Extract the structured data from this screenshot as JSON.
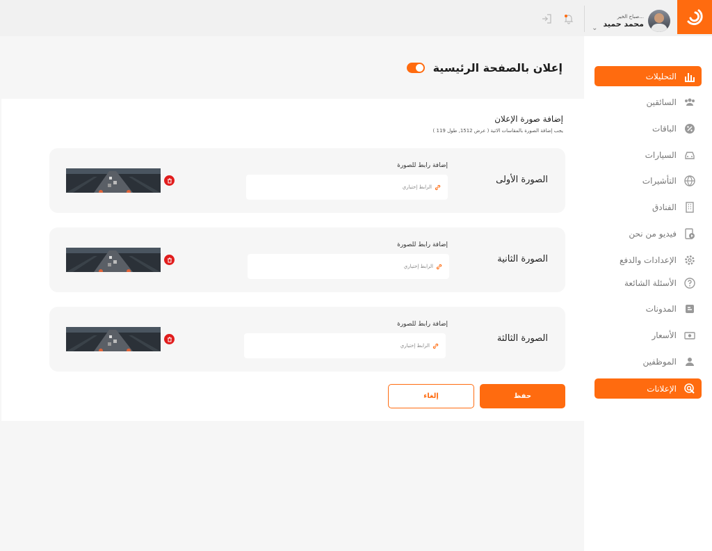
{
  "header": {
    "greeting": "صباح الخير...",
    "user_name": "محمد حميد"
  },
  "sidebar": {
    "items": [
      {
        "label": "التحليلات",
        "icon": "chart-icon",
        "active": true
      },
      {
        "label": "السائقين",
        "icon": "users-icon",
        "active": false
      },
      {
        "label": "الباقات",
        "icon": "discount-icon",
        "active": false
      },
      {
        "label": "السيارات",
        "icon": "car-icon",
        "active": false
      },
      {
        "label": "التأشيرات",
        "icon": "globe-icon",
        "active": false
      },
      {
        "label": "الفنادق",
        "icon": "building-icon",
        "active": false
      },
      {
        "label": "فيديو من نحن",
        "icon": "video-icon",
        "active": false
      },
      {
        "label": "الإعدادات والدفع",
        "icon": "gear-icon",
        "active": false
      },
      {
        "label": "الأسئلة الشائعة",
        "icon": "question-icon",
        "active": false
      },
      {
        "label": "المدونات",
        "icon": "blog-icon",
        "active": false
      },
      {
        "label": "الأسعار",
        "icon": "money-icon",
        "active": false
      },
      {
        "label": "الموظفين",
        "icon": "person-icon",
        "active": false
      },
      {
        "label": "الإعلانات",
        "icon": "ads-icon",
        "active": true
      }
    ]
  },
  "page": {
    "title": "إعلان بالصفحة الرئيسية",
    "toggle_on": true
  },
  "section": {
    "title": "إضافة صورة الإعلان",
    "subtitle": "يجب إضافة الصورة بالمقاسات الاتية ( عرض 1512, طول 119 )"
  },
  "rows": [
    {
      "label": "الصورة الأولى",
      "link_label": "إضافة رابط للصورة",
      "placeholder": "الرابط إختياري"
    },
    {
      "label": "الصورة الثانية",
      "link_label": "إضافة رابط للصورة",
      "placeholder": "الرابط إختياري"
    },
    {
      "label": "الصورة الثالثة",
      "link_label": "إضافة رابط للصورة",
      "placeholder": "الرابط إختياري"
    }
  ],
  "actions": {
    "save": "حفظ",
    "cancel": "إلغاء"
  },
  "colors": {
    "accent": "#ff6b0f",
    "danger": "#e11d1d"
  }
}
